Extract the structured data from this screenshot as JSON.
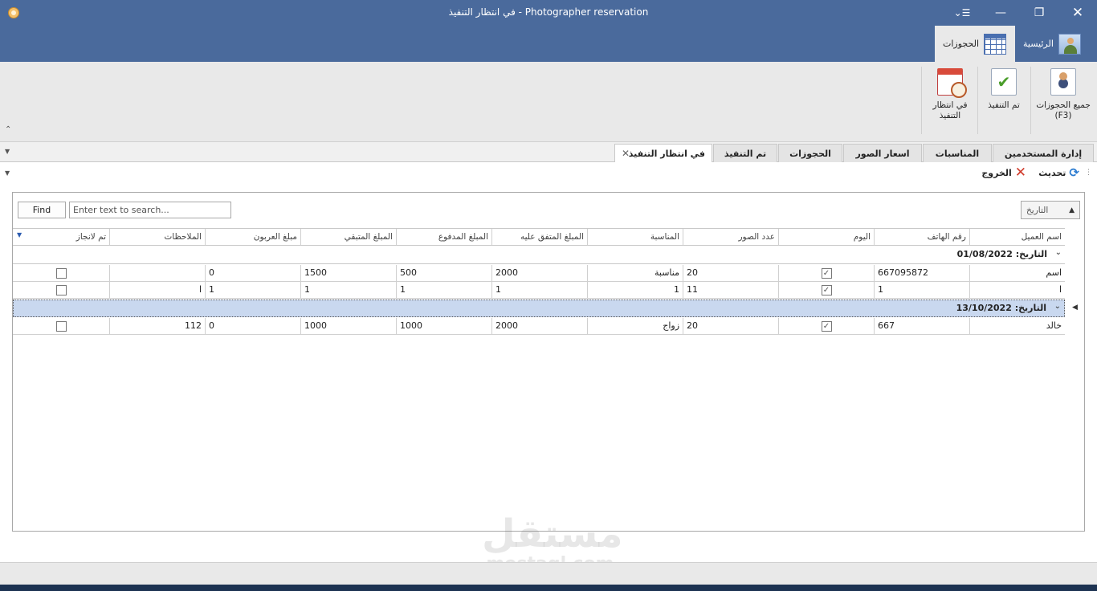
{
  "window": {
    "title": "في انتظار التنفيذ - Photographer reservation",
    "menu_glyph": "⌄☰",
    "minimize_glyph": "—",
    "maximize_glyph": "❐",
    "close_glyph": "✕"
  },
  "ribbon": {
    "tabs": [
      {
        "label": "الرئيسية",
        "icon": "person-board-icon",
        "active": false
      },
      {
        "label": "الحجوزات",
        "icon": "calendar-grid-icon",
        "active": true
      }
    ],
    "buttons": {
      "all_bookings": "جميع الحجوزات (F3)",
      "done": "تم التنفيذ",
      "pending": "في انتظار التنفيذ"
    },
    "collapse_glyph": "⌃"
  },
  "doc_tabs": [
    {
      "label": "إدارة المستخدمين",
      "active": false
    },
    {
      "label": "المناسبات",
      "active": false
    },
    {
      "label": "اسعار الصور",
      "active": false
    },
    {
      "label": "الحجوزات",
      "active": false
    },
    {
      "label": "تم التنفيذ",
      "active": false
    },
    {
      "label": "في انتظار التنفيذ",
      "active": true
    }
  ],
  "toolbar": {
    "refresh_label": "تحديث",
    "exit_label": "الخروج"
  },
  "grid": {
    "find_label": "Find",
    "search_placeholder": "Enter text to search...",
    "group_by_chip": "التاريخ",
    "columns": [
      "اسم العميل",
      "رقم الهاتف",
      "اليوم",
      "عدد الصور",
      "المناسبة",
      "المبلغ المتفق عليه",
      "المبلغ المدفوع",
      "المبلغ المتبقي",
      "مبلغ العربون",
      "الملاحظات",
      "تم لانجاز"
    ],
    "groups": [
      {
        "label": "التاريخ: 01/08/2022"
      },
      {
        "label": "التاريخ: 13/10/2022"
      }
    ],
    "rows": [
      {
        "client": "اسم",
        "phone": "667095872",
        "day": true,
        "photos": "20",
        "occasion": "مناسبة",
        "agreed": "2000",
        "paid": "500",
        "remaining": "1500",
        "deposit": "0",
        "notes": "",
        "done": false
      },
      {
        "client": "ا",
        "phone": "1",
        "day": true,
        "photos": "11",
        "occasion": "1",
        "agreed": "1",
        "paid": "1",
        "remaining": "1",
        "deposit": "1",
        "notes": "ا",
        "done": false
      },
      {
        "client": "خالد",
        "phone": "667",
        "day": true,
        "photos": "20",
        "occasion": "زواج",
        "agreed": "2000",
        "paid": "1000",
        "remaining": "1000",
        "deposit": "0",
        "notes": "112",
        "done": false
      }
    ]
  },
  "watermark": {
    "arabic": "مستقل",
    "latin": "mostaql.com"
  }
}
